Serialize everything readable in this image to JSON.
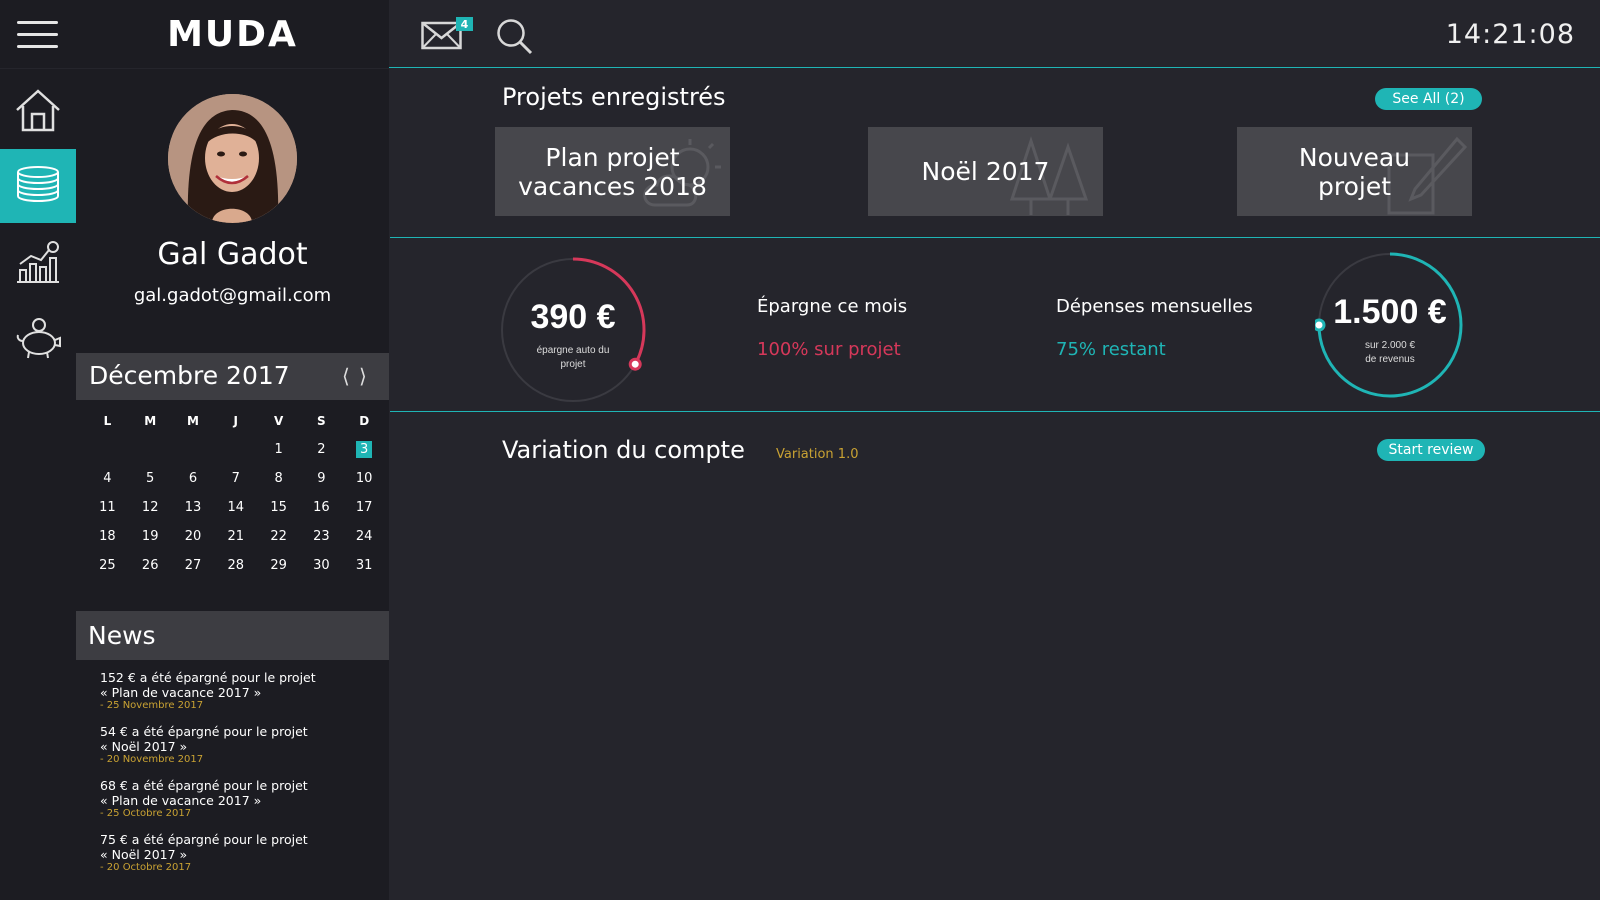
{
  "brand": "MUDA",
  "header": {
    "mail_count": "4",
    "clock": "14:21:08"
  },
  "rail": {
    "items": [
      "home-icon",
      "coins-icon",
      "stats-icon",
      "piggy-bank-icon"
    ],
    "active": "coins-icon"
  },
  "profile": {
    "name": "Gal Gadot",
    "email": "gal.gadot@gmail.com"
  },
  "calendar": {
    "title": "Décembre 2017",
    "weekdays": [
      "L",
      "M",
      "M",
      "J",
      "V",
      "S",
      "D"
    ],
    "weeks": [
      [
        "",
        "",
        "",
        "",
        "1",
        "2",
        "3"
      ],
      [
        "4",
        "5",
        "6",
        "7",
        "8",
        "9",
        "10"
      ],
      [
        "11",
        "12",
        "13",
        "14",
        "15",
        "16",
        "17"
      ],
      [
        "18",
        "19",
        "20",
        "21",
        "22",
        "23",
        "24"
      ],
      [
        "25",
        "26",
        "27",
        "28",
        "29",
        "30",
        "31"
      ]
    ],
    "today": "3"
  },
  "news": {
    "title": "News",
    "items": [
      {
        "line1": "152 € a été épargné pour le projet",
        "line2": "« Plan de vacance 2017 »",
        "date": "- 25 Novembre 2017"
      },
      {
        "line1": "54 € a été épargné pour le projet",
        "line2": "« Noël 2017 »",
        "date": "- 20 Novembre 2017"
      },
      {
        "line1": "68 € a été épargné pour le projet",
        "line2": "« Plan de vacance 2017 »",
        "date": "- 25 Octobre 2017"
      },
      {
        "line1": "75 € a été épargné pour le projet",
        "line2": "« Noël 2017 »",
        "date": "- 20 Octobre 2017"
      }
    ]
  },
  "projects": {
    "title": "Projets enregistrés",
    "see_all": "See All (2)",
    "cards": [
      {
        "label_l1": "Plan projet",
        "label_l2": "vacances 2018"
      },
      {
        "label_l1": "Noël 2017",
        "label_l2": ""
      },
      {
        "label_l1": "Nouveau",
        "label_l2": "projet"
      }
    ]
  },
  "stats": {
    "savings_gauge": {
      "amount": "390 €",
      "caption_l1": "épargne auto du",
      "caption_l2": "projet",
      "fraction": 0.33,
      "color": "#d6385a"
    },
    "savings_label": "Épargne ce mois",
    "savings_value": "100% sur projet",
    "expenses_label": "Dépenses mensuelles",
    "expenses_value": "75% restant",
    "expenses_gauge": {
      "amount": "1.500 €",
      "caption_l1": "sur 2.000 €",
      "caption_l2": "de revenus",
      "fraction": 0.75,
      "color": "#1fb5b5"
    }
  },
  "variation": {
    "title": "Variation du compte",
    "version": "Variation 1.0",
    "review_button": "Start review"
  },
  "colors": {
    "accent": "#1fb5b5",
    "danger": "#d6385a",
    "gold": "#c9a233"
  }
}
